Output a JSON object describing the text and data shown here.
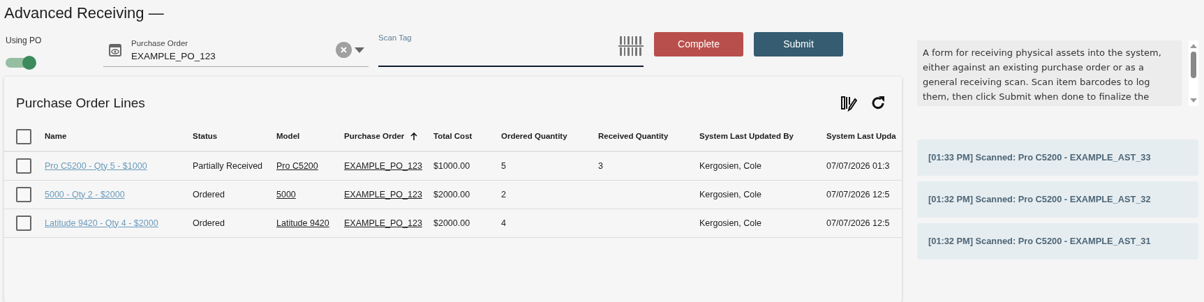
{
  "title": "Advanced Receiving —",
  "using_po": {
    "label": "Using PO",
    "on": true
  },
  "purchase_order": {
    "label": "Purchase Order",
    "value": "EXAMPLE_PO_123"
  },
  "scan_tag": {
    "label": "Scan Tag"
  },
  "buttons": [
    {
      "label": "Complete",
      "kind": "danger"
    },
    {
      "label": "Submit",
      "kind": "primary"
    }
  ],
  "table": {
    "title": "Purchase Order Lines",
    "all_selected": false,
    "columns": [
      {
        "label": "Name",
        "sorted": false
      },
      {
        "label": "Status",
        "sorted": false
      },
      {
        "label": "Model",
        "sorted": false
      },
      {
        "label": "Purchase Order",
        "sorted": true
      },
      {
        "label": "Total Cost",
        "sorted": false
      },
      {
        "label": "Ordered Quantity",
        "sorted": false
      },
      {
        "label": "Received Quantity",
        "sorted": false
      },
      {
        "label": "System Last Updated By",
        "sorted": false
      },
      {
        "label": "System Last Upda",
        "sorted": false
      }
    ],
    "rows": [
      {
        "selected": false,
        "cells": [
          "Pro C5200 - Qty 5 - $1000",
          "Partially Received",
          "Pro C5200",
          "EXAMPLE_PO_123",
          "$1000.00",
          "5",
          "3",
          "Kergosien, Cole",
          "07/07/2026 01:3"
        ]
      },
      {
        "selected": false,
        "cells": [
          "5000 - Qty 2 - $2000",
          "Ordered",
          "5000",
          "EXAMPLE_PO_123",
          "$2000.00",
          "2",
          "",
          "Kergosien, Cole",
          "07/07/2026 12:5"
        ]
      },
      {
        "selected": false,
        "cells": [
          "Latitude 9420 - Qty 4 - $2000",
          "Ordered",
          "Latitude 9420",
          "EXAMPLE_PO_123",
          "$2000.00",
          "4",
          "",
          "Kergosien, Cole",
          "07/07/2026 12:5"
        ]
      }
    ]
  },
  "description": "A form for receiving physical assets into the system, either against an existing purchase order or as a general receiving scan. Scan item barcodes to log them, then click Submit when done to finalize the",
  "scan_log": [
    "[01:33 PM] Scanned: Pro C5200 - EXAMPLE_AST_33",
    "[01:32 PM] Scanned: Pro C5200 - EXAMPLE_AST_32",
    "[01:32 PM] Scanned: Pro C5200 - EXAMPLE_AST_31"
  ]
}
